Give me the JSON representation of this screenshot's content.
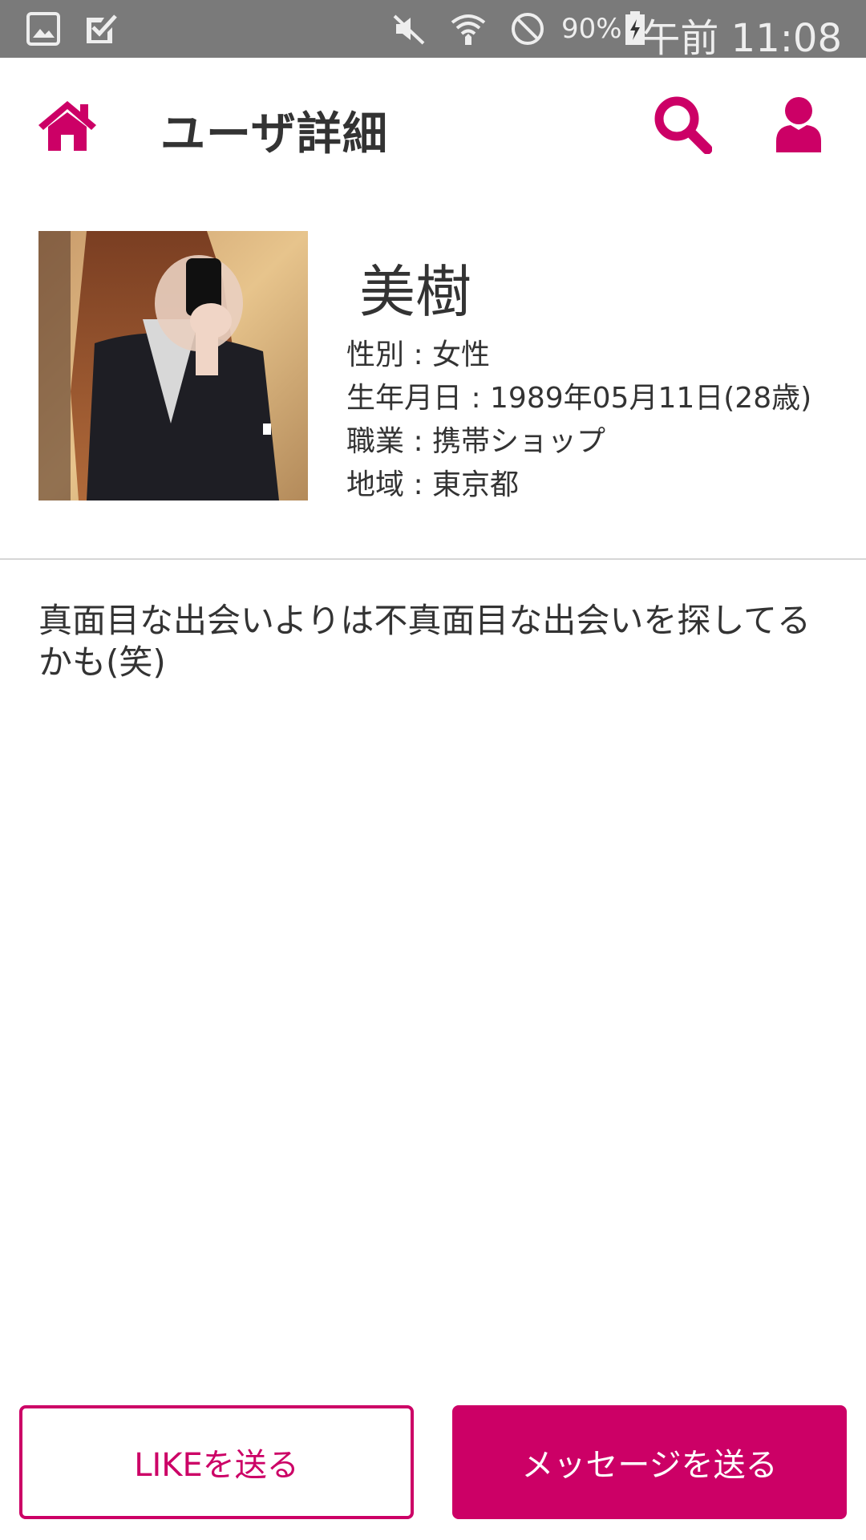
{
  "status_bar": {
    "battery_percent": "90%",
    "time": "午前 11:08",
    "icons": [
      "gallery-icon",
      "task-check-icon",
      "mute-icon",
      "wifi-icon",
      "do-not-disturb-icon",
      "battery-charging-icon"
    ]
  },
  "header": {
    "title": "ユーザ詳細",
    "icons": [
      "home-icon",
      "search-icon",
      "user-icon"
    ]
  },
  "profile": {
    "name": "美樹",
    "gender": "性別 : 女性",
    "birthday": "生年月日 : 1989年05月11日(28歳)",
    "occupation": "職業 : 携帯ショップ",
    "region": "地域 : 東京都"
  },
  "bio": "真面目な出会いよりは不真面目な出会いを探してるかも(笑)",
  "actions": {
    "like_label": "LIKEを送る",
    "message_label": "メッセージを送る"
  },
  "colors": {
    "accent": "#cc0066",
    "status_bar": "#7a7a7a",
    "text": "#333333"
  }
}
